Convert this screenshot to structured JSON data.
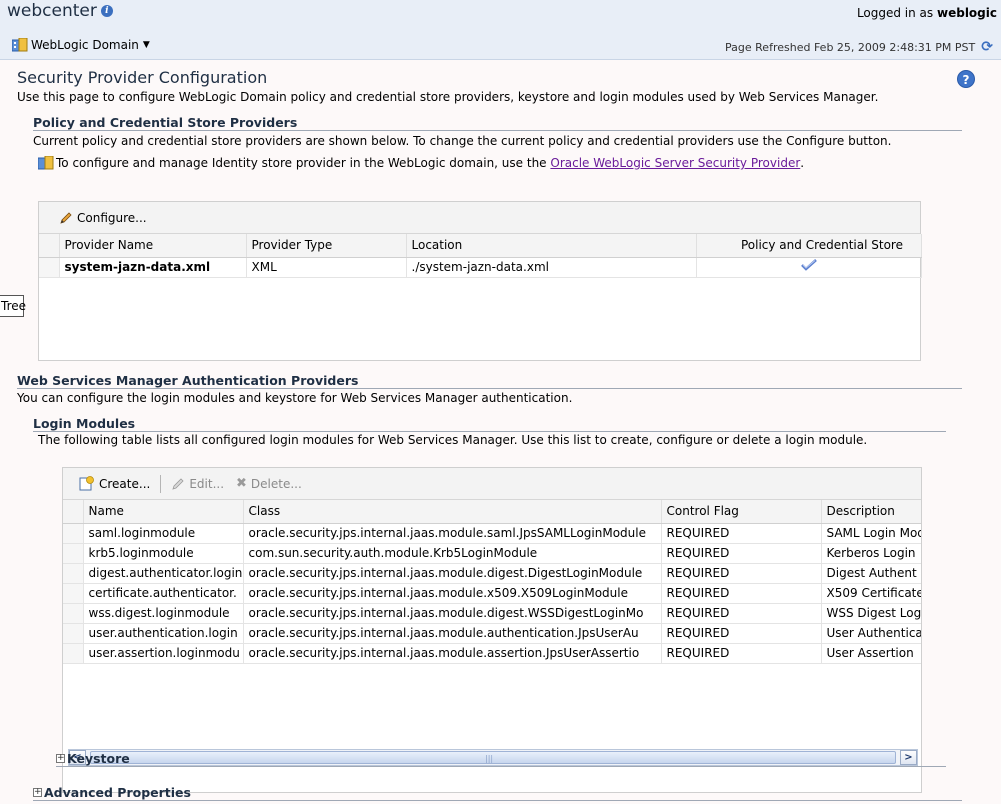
{
  "header": {
    "app_name": "webcenter",
    "domain_menu_label": "WebLogic Domain",
    "logged_in_prefix": "Logged in as",
    "logged_in_user": "weblogic",
    "refreshed_text": "Page Refreshed Feb 25, 2009 2:48:31 PM PST"
  },
  "page": {
    "title": "Security Provider Configuration",
    "description": "Use this page to configure WebLogic Domain policy and credential store providers, keystore and login modules used by Web Services Manager."
  },
  "policy_section": {
    "heading": "Policy and Credential Store Providers",
    "text1": "Current policy and credential store providers are shown below. To change the current policy and credential providers use the Configure button.",
    "text2_prefix": "To configure and manage Identity store provider in the WebLogic domain, use the",
    "text2_link": "Oracle WebLogic Server Security Provider",
    "text2_suffix": ".",
    "configure_label": "Configure...",
    "columns": [
      "Provider Name",
      "Provider Type",
      "Location",
      "Policy and Credential Store"
    ],
    "row": {
      "name": "system-jazn-data.xml",
      "type": "XML",
      "location": "./system-jazn-data.xml"
    }
  },
  "tooltip": {
    "text": "Tree"
  },
  "wsm_section": {
    "heading": "Web Services Manager Authentication Providers",
    "text": "You can configure the login modules and keystore for Web Services Manager authentication."
  },
  "login_modules": {
    "heading": "Login Modules",
    "text": "The following table lists all configured login modules for Web Services Manager. Use this list to create, configure or delete a login module.",
    "create_label": "Create...",
    "edit_label": "Edit...",
    "delete_label": "Delete...",
    "columns": [
      "Name",
      "Class",
      "Control Flag",
      "Description"
    ],
    "rows": [
      {
        "name": "saml.loginmodule",
        "class": "oracle.security.jps.internal.jaas.module.saml.JpsSAMLLoginModule",
        "flag": "REQUIRED",
        "desc": "SAML Login Mod"
      },
      {
        "name": "krb5.loginmodule",
        "class": "com.sun.security.auth.module.Krb5LoginModule",
        "flag": "REQUIRED",
        "desc": "Kerberos Login"
      },
      {
        "name": "digest.authenticator.login",
        "class": "oracle.security.jps.internal.jaas.module.digest.DigestLoginModule",
        "flag": "REQUIRED",
        "desc": "Digest Authent"
      },
      {
        "name": "certificate.authenticator.",
        "class": "oracle.security.jps.internal.jaas.module.x509.X509LoginModule",
        "flag": "REQUIRED",
        "desc": "X509 Certificate"
      },
      {
        "name": "wss.digest.loginmodule",
        "class": "oracle.security.jps.internal.jaas.module.digest.WSSDigestLoginMo",
        "flag": "REQUIRED",
        "desc": "WSS Digest Log"
      },
      {
        "name": "user.authentication.login",
        "class": "oracle.security.jps.internal.jaas.module.authentication.JpsUserAu",
        "flag": "REQUIRED",
        "desc": "User Authentica"
      },
      {
        "name": "user.assertion.loginmodu",
        "class": "oracle.security.jps.internal.jaas.module.assertion.JpsUserAssertio",
        "flag": "REQUIRED",
        "desc": "User Assertion"
      }
    ]
  },
  "keystore": {
    "label": "Keystore"
  },
  "advanced": {
    "label": "Advanced Properties"
  }
}
